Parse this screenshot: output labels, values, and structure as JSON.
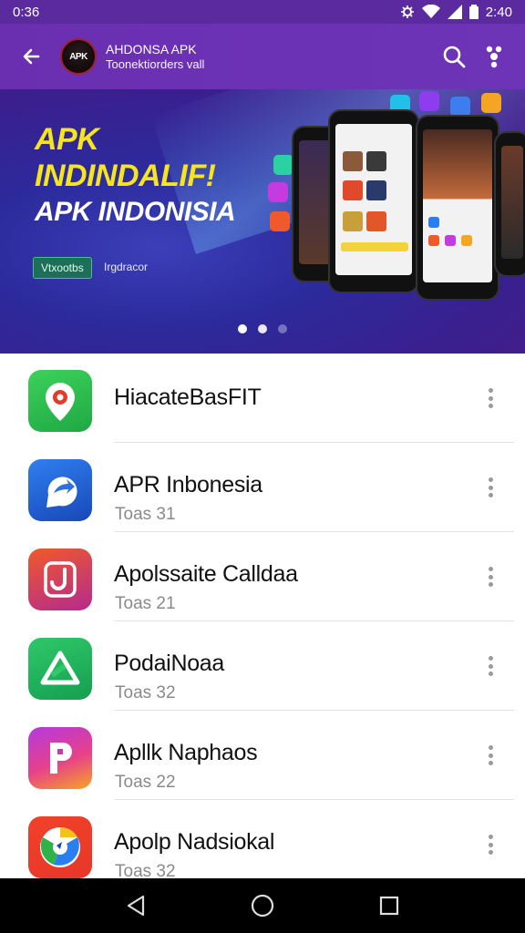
{
  "status_bar": {
    "time_left": "0:36",
    "time_right": "2:40"
  },
  "app_bar": {
    "logo_text": "APK",
    "title": "AHDONSA APK",
    "subtitle": "Toonektiorders vall",
    "icons": [
      "back-arrow-icon",
      "search-icon",
      "more-vert-icon"
    ]
  },
  "banner": {
    "headline_1": "APK",
    "headline_2": "INDINDALIF!",
    "headline_3": "APK INDONISIA",
    "pill_label": "Vtxootbs",
    "sub_label": "Irgdracor",
    "pager_count": 3,
    "pager_active_index": 0
  },
  "apps": [
    {
      "name": "HiacateBasFIT",
      "subtitle": "",
      "icon": "location-pin-icon",
      "icon_colors": [
        "#3dd15a",
        "#1fa844"
      ]
    },
    {
      "name": "APR Inbonesia",
      "subtitle": "Toas 31",
      "icon": "share-arrow-icon",
      "icon_colors": [
        "#2f7ff0",
        "#1848b8"
      ]
    },
    {
      "name": "Apolssaite Calldaa",
      "subtitle": "Toas 21",
      "icon": "letter-j-icon",
      "icon_colors": [
        "#f05a2a",
        "#b42a8e"
      ]
    },
    {
      "name": "PodaiNoaa",
      "subtitle": "Toas 32",
      "icon": "triangle-icon",
      "icon_colors": [
        "#2fc86a",
        "#159e50"
      ]
    },
    {
      "name": "Apllk Naphaos",
      "subtitle": "Toas 22",
      "icon": "letter-p-icon",
      "icon_colors": [
        "#b23adf",
        "#f5a524"
      ]
    },
    {
      "name": "Apolp Nadsiokal",
      "subtitle": "Toas 32",
      "icon": "chrome-like-icon",
      "icon_colors": [
        "#f0422a",
        "#2a7ff0"
      ]
    }
  ],
  "nav_bar": {
    "buttons": [
      "back-triangle-icon",
      "home-circle-icon",
      "recents-square-icon"
    ]
  },
  "colors": {
    "app_bar": "#6a2fb0",
    "status_bar": "#5b2a9e",
    "banner_bg": "#2c2a9c",
    "headline_yellow": "#f5e51e",
    "divider": "#e2e2e2",
    "nav_bar": "#000000"
  }
}
